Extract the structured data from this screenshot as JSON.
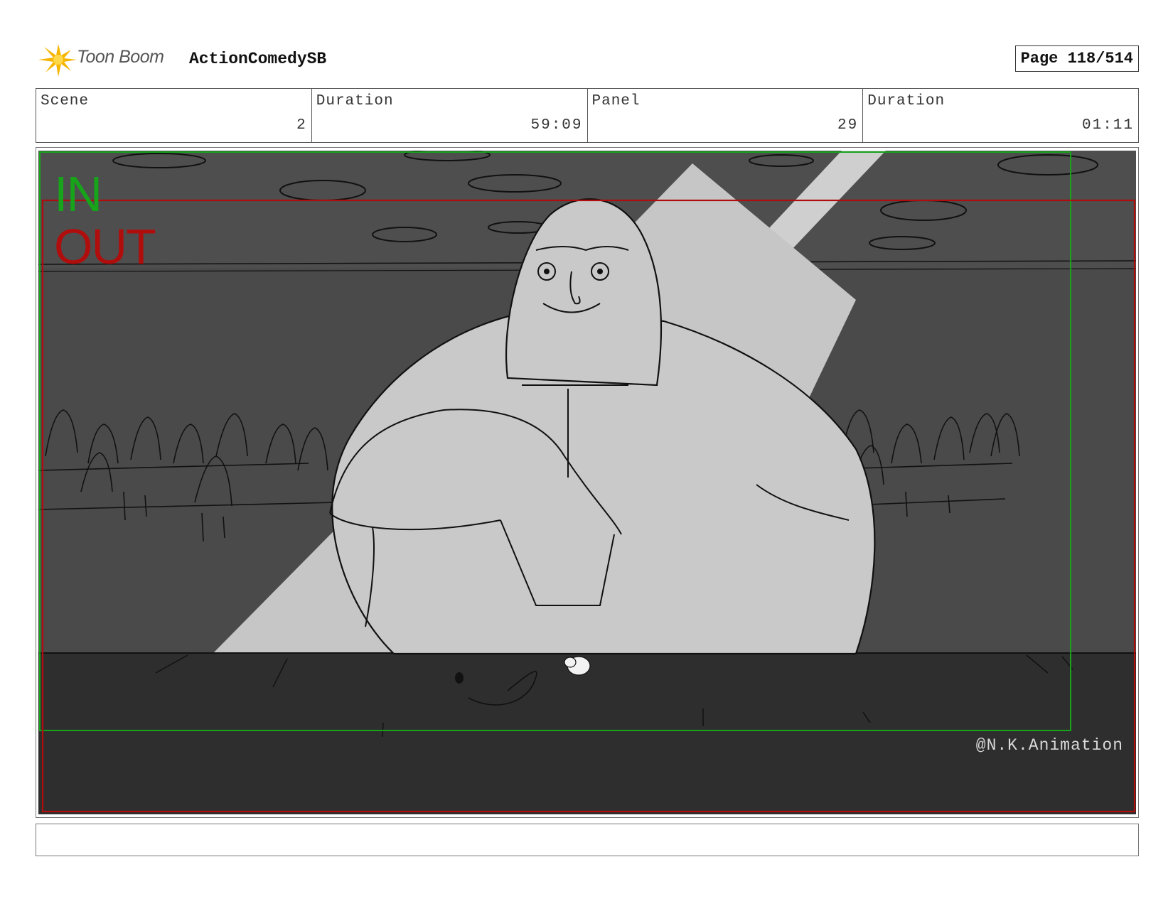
{
  "header": {
    "logo_text": "Toon Boom",
    "project_title": "ActionComedySB",
    "page_label": "Page 118/514"
  },
  "info": {
    "scene_label": "Scene",
    "scene_value": "2",
    "scene_duration_label": "Duration",
    "scene_duration_value": "59:09",
    "panel_label": "Panel",
    "panel_value": "29",
    "panel_duration_label": "Duration",
    "panel_duration_value": "01:11"
  },
  "panel": {
    "in_marker": "IN",
    "out_marker": "OUT",
    "watermark": "@N.K.Animation"
  },
  "colors": {
    "in_frame": "#17a31a",
    "out_frame": "#b00d0d",
    "wall": "#4a4a4a",
    "table": "#2e2e2e",
    "figure": "#cacaca"
  },
  "notes": {
    "text": ""
  }
}
